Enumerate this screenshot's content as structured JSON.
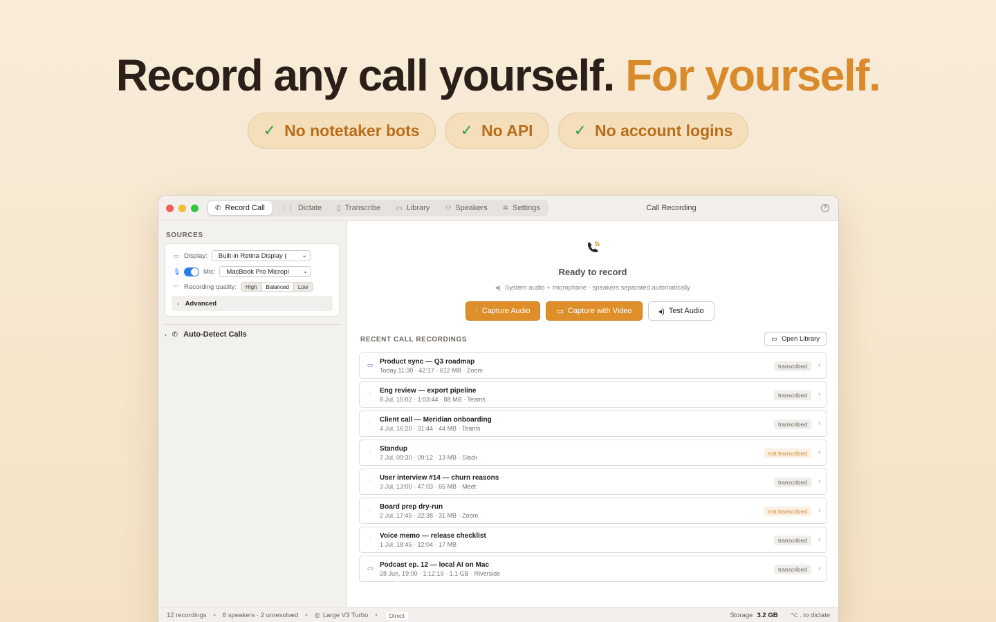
{
  "hero": {
    "title_main": "Record any call yourself.",
    "title_accent": "For yourself.",
    "pills": [
      "No notetaker bots",
      "No API",
      "No account logins"
    ],
    "accent_color": "#d98a2b",
    "check_color": "#2f9b57"
  },
  "window": {
    "title": "Call Recording",
    "tabs": [
      {
        "label": "Record Call",
        "icon": "phone-icon",
        "active": true
      },
      {
        "label": "Dictate",
        "icon": "waveform-icon",
        "active": false
      },
      {
        "label": "Transcribe",
        "icon": "document-icon",
        "active": false
      },
      {
        "label": "Library",
        "icon": "archive-icon",
        "active": false
      },
      {
        "label": "Speakers",
        "icon": "people-icon",
        "active": false
      },
      {
        "label": "Settings",
        "icon": "gear-icon",
        "active": false
      }
    ]
  },
  "sidebar": {
    "heading": "SOURCES",
    "display_label": "Display:",
    "display_value": "Built-in Retina Display (",
    "mic_label": "Mic:",
    "mic_value": "MacBook Pro Micropl",
    "mic_enabled": true,
    "quality_label": "Recording quality:",
    "quality_options": [
      "High",
      "Balanced",
      "Low"
    ],
    "quality_selected": "Balanced",
    "advanced_label": "Advanced",
    "auto_detect_label": "Auto-Detect Calls"
  },
  "main": {
    "ready_title": "Ready to record",
    "ready_subtitle": "System audio + microphone · speakers separated automatically",
    "capture_audio": "Capture Audio",
    "capture_video": "Capture with Video",
    "test_audio": "Test Audio",
    "recent_heading": "RECENT CALL RECORDINGS",
    "open_library": "Open Library",
    "recordings": [
      {
        "title": "Product sync — Q3 roadmap",
        "meta": "Today 11:30 · 42:17 · 612 MB · Zoom",
        "kind": "video",
        "status": "transcribed"
      },
      {
        "title": "Eng review — export pipeline",
        "meta": "8 Jul, 15:02 · 1:03:44 · 88 MB · Teams",
        "kind": "audio",
        "status": "transcribed"
      },
      {
        "title": "Client call — Meridian onboarding",
        "meta": "4 Jul, 16:20 · 31:44 · 44 MB · Teams",
        "kind": "audio",
        "status": "transcribed"
      },
      {
        "title": "Standup",
        "meta": "7 Jul, 09:30 · 09:12 · 13 MB · Slack",
        "kind": "audio",
        "status": "not transcribed"
      },
      {
        "title": "User interview #14 — churn reasons",
        "meta": "3 Jul, 13:00 · 47:03 · 65 MB · Meet",
        "kind": "audio",
        "status": "transcribed"
      },
      {
        "title": "Board prep dry-run",
        "meta": "2 Jul, 17:45 · 22:38 · 31 MB · Zoom",
        "kind": "audio",
        "status": "not transcribed"
      },
      {
        "title": "Voice memo — release checklist",
        "meta": "1 Jul, 18:45 · 12:04 · 17 MB",
        "kind": "audio",
        "status": "transcribed"
      },
      {
        "title": "Podcast ep. 12 — local AI on Mac",
        "meta": "28 Jun, 19:00 · 1:12:19 · 1.1 GB · Riverside",
        "kind": "video",
        "status": "transcribed"
      }
    ]
  },
  "status": {
    "recordings": "12 recordings",
    "speakers": "8 speakers · 2 unresolved",
    "model": "Large V3 Turbo",
    "mode": "Direct",
    "storage_label": "Storage",
    "storage_value": "3.2 GB",
    "shortcut": "⌥ . to dictate"
  }
}
